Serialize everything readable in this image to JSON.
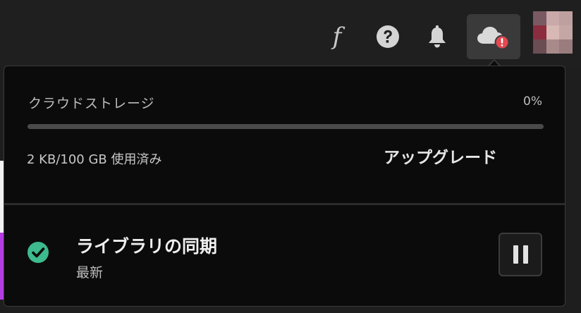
{
  "topbar": {
    "icons": [
      "fonts-icon",
      "help-icon",
      "bell-icon",
      "cloud-alert-icon"
    ],
    "cloud_badge": "!",
    "fonts_glyph": "f"
  },
  "storage": {
    "title": "クラウドストレージ",
    "percent_label": "0%",
    "percent_value": 0,
    "usage": "2 KB/100 GB 使用済み",
    "upgrade_label": "アップグレード"
  },
  "sync": {
    "title": "ライブラリの同期",
    "status": "最新",
    "status_icon": "check-circle-icon",
    "pause_icon": "pause-icon"
  },
  "colors": {
    "accent_green": "#3dba8e",
    "alert_red": "#e34850",
    "popover_bg": "#0b0b0b"
  }
}
